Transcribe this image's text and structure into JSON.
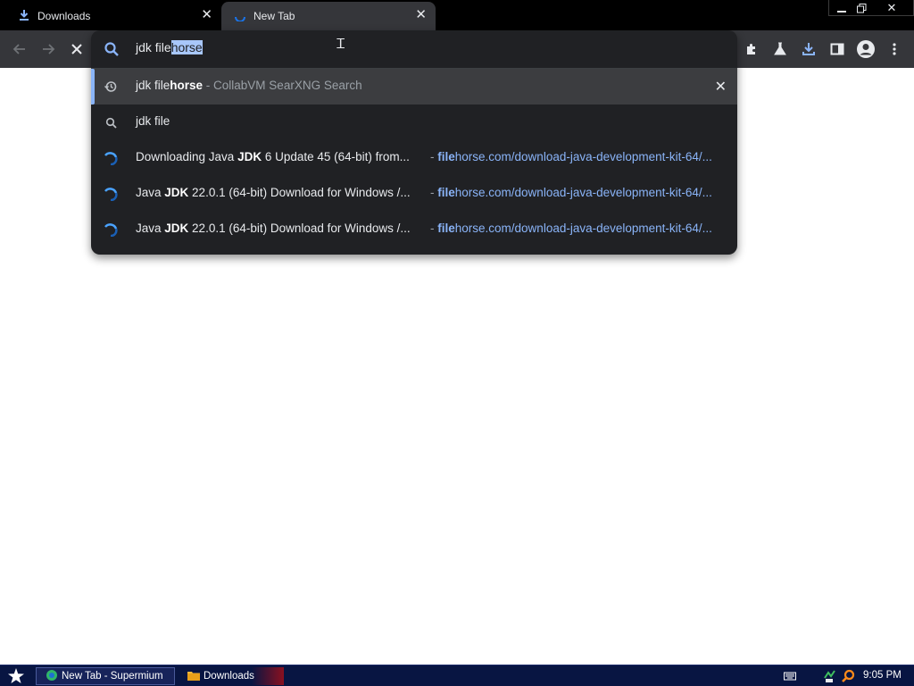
{
  "tabs": [
    {
      "label": "Downloads",
      "icon": "download-icon"
    },
    {
      "label": "New Tab",
      "icon": "loading-spinner-icon"
    }
  ],
  "window_controls": [
    "minimize-icon",
    "restore-icon",
    "close-icon"
  ],
  "omnibox": {
    "typed_text": "jdk file",
    "autocomplete_text": "horse"
  },
  "suggestions": [
    {
      "icon": "history-icon",
      "query_plain": "jdk file",
      "query_bold": "horse",
      "source": " - CollabVM SearXNG Search",
      "removable": true
    },
    {
      "icon": "search-icon",
      "query_plain": "jdk file"
    },
    {
      "icon": "site-favicon-icon",
      "title_pre": "Downloading Java ",
      "title_bold": "JDK",
      "title_post": " 6 Update 45 (64-bit) from...",
      "url_dash": " - ",
      "url_bold": "file",
      "url_rest": "horse.com/download-java-development-kit-64/..."
    },
    {
      "icon": "site-favicon-icon",
      "title_pre": "Java ",
      "title_bold": "JDK",
      "title_post": " 22.0.1 (64-bit) Download for Windows /...",
      "url_dash": " - ",
      "url_bold": "file",
      "url_rest": "horse.com/download-java-development-kit-64/..."
    },
    {
      "icon": "site-favicon-icon",
      "title_pre": "Java ",
      "title_bold": "JDK",
      "title_post": " 22.0.1 (64-bit) Download for Windows /...",
      "url_dash": " - ",
      "url_bold": "file",
      "url_rest": "horse.com/download-java-development-kit-64/..."
    }
  ],
  "toolbar_icons": [
    "back-icon",
    "forward-icon",
    "stop-icon",
    "extensions-icon",
    "labs-flask-icon",
    "downloads-icon",
    "side-panel-icon",
    "profile-icon",
    "menu-icon"
  ],
  "taskbar": {
    "tasks": [
      {
        "label": "New Tab - Supermium",
        "icon": "supermium-icon"
      },
      {
        "label": "Downloads",
        "icon": "folder-icon"
      }
    ],
    "clock": "9:05 PM"
  },
  "colors": {
    "tabstrip": "#000000",
    "toolbar": "#35363a",
    "omnibox_bg": "#202124",
    "accent": "#8ab4f8",
    "taskbar": "#081542"
  }
}
